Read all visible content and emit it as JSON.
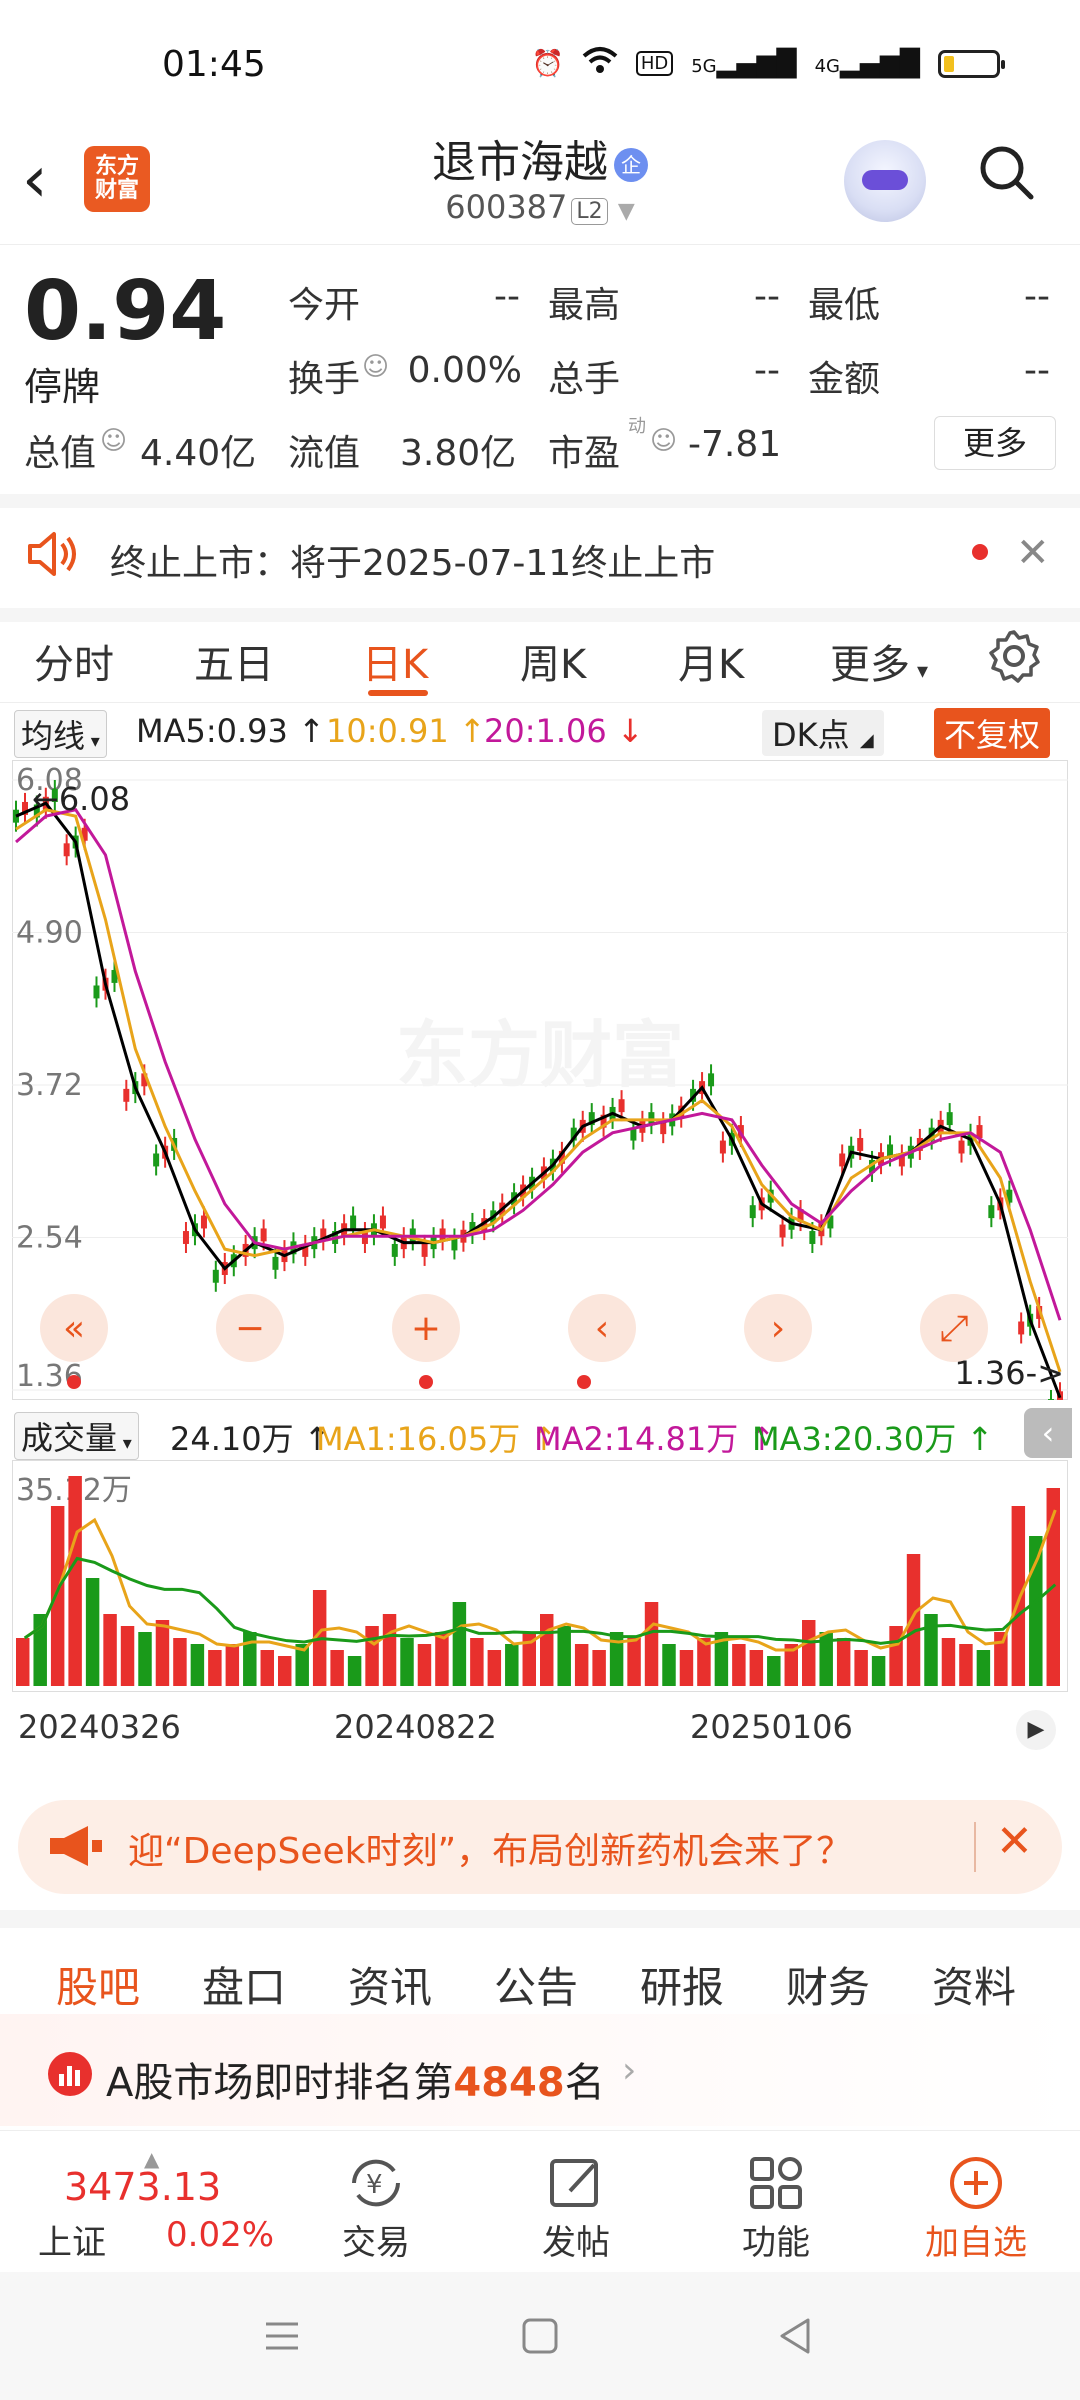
{
  "status_bar": {
    "time": "01:45",
    "network": "HD",
    "sig1": "5G",
    "sig2": "4G"
  },
  "header": {
    "title": "退市海越",
    "badge": "企",
    "code": "600387",
    "level": "L2",
    "logo_line1": "东方",
    "logo_line2": "财富"
  },
  "quote": {
    "price": "0.94",
    "status": "停牌",
    "fields": [
      {
        "label": "今开",
        "value": "--"
      },
      {
        "label": "最高",
        "value": "--"
      },
      {
        "label": "最低",
        "value": "--"
      },
      {
        "label": "换手",
        "value": "0.00%"
      },
      {
        "label": "总手",
        "value": "--"
      },
      {
        "label": "金额",
        "value": "--"
      },
      {
        "label": "总值",
        "value": "4.40亿"
      },
      {
        "label": "流值",
        "value": "3.80亿"
      },
      {
        "label": "市盈",
        "value": "-7.81",
        "sup": "动"
      }
    ],
    "more_label": "更多"
  },
  "notice": {
    "text": "终止上市：将于2025-07-11终止上市"
  },
  "tabs": [
    "分时",
    "五日",
    "日K",
    "周K",
    "月K",
    "更多"
  ],
  "active_tab": "日K",
  "ma": {
    "selector": "均线",
    "ma5": "MA5:0.93",
    "ma10": "10:0.91",
    "ma20": "20:1.06",
    "dk_label": "DK点",
    "adjust_label": "不复权",
    "colors": {
      "ma5": "#000000",
      "ma10": "#e8a41a",
      "ma20": "#c2189a",
      "up": "#e8302d",
      "down": "#1a9a1a"
    }
  },
  "chart_data": [
    {
      "type": "line",
      "title": "日K",
      "y_ticks": [
        "6.08",
        "4.90",
        "3.72",
        "2.54",
        "1.36"
      ],
      "ylim": [
        1.36,
        6.08
      ],
      "high_marker": "6.08",
      "low_marker": "1.36",
      "x_labels": [
        "20240326",
        "20240822",
        "20250106"
      ],
      "watermark": "东方财富",
      "series": [
        {
          "name": "MA5",
          "values": [
            5.8,
            5.9,
            5.6,
            4.5,
            3.7,
            3.2,
            2.6,
            2.3,
            2.5,
            2.4,
            2.5,
            2.6,
            2.6,
            2.5,
            2.5,
            2.55,
            2.7,
            2.9,
            3.1,
            3.4,
            3.5,
            3.4,
            3.45,
            3.7,
            3.3,
            2.8,
            2.65,
            2.6,
            3.2,
            3.15,
            3.2,
            3.4,
            3.3,
            2.8,
            1.9,
            1.3
          ]
        },
        {
          "name": "10",
          "values": [
            5.7,
            5.85,
            5.8,
            5.0,
            4.0,
            3.4,
            2.9,
            2.45,
            2.4,
            2.45,
            2.5,
            2.55,
            2.6,
            2.55,
            2.5,
            2.55,
            2.65,
            2.85,
            3.05,
            3.3,
            3.45,
            3.45,
            3.45,
            3.6,
            3.4,
            2.95,
            2.7,
            2.6,
            3.0,
            3.15,
            3.2,
            3.35,
            3.35,
            3.0,
            2.2,
            1.5
          ]
        },
        {
          "name": "20",
          "values": [
            5.6,
            5.8,
            5.85,
            5.5,
            4.6,
            3.9,
            3.3,
            2.8,
            2.5,
            2.45,
            2.5,
            2.55,
            2.55,
            2.55,
            2.55,
            2.55,
            2.6,
            2.75,
            2.95,
            3.2,
            3.35,
            3.4,
            3.45,
            3.5,
            3.45,
            3.1,
            2.8,
            2.65,
            2.9,
            3.1,
            3.2,
            3.3,
            3.35,
            3.2,
            2.6,
            1.9
          ]
        }
      ]
    },
    {
      "type": "bar",
      "title": "成交量",
      "y_max_label": "35.12万",
      "current": "24.10万",
      "ma1": "MA1:16.05万",
      "ma2": "MA2:14.81万",
      "ma3": "MA3:20.30万",
      "values": [
        8,
        12,
        30,
        35,
        18,
        12,
        10,
        9,
        11,
        8,
        7,
        6,
        7,
        9,
        6,
        5,
        7,
        16,
        6,
        5,
        10,
        12,
        8,
        7,
        9,
        14,
        8,
        6,
        7,
        9,
        12,
        10,
        7,
        6,
        9,
        8,
        14,
        7,
        6,
        8,
        9,
        7,
        6,
        5,
        7,
        11,
        9,
        8,
        6,
        5,
        10,
        22,
        12,
        8,
        7,
        6,
        9,
        30,
        25,
        33
      ]
    }
  ],
  "controls": [
    "«",
    "−",
    "+",
    "‹",
    "›",
    "⤢"
  ],
  "ad": {
    "text": "迎“DeepSeek时刻”，布局创新药机会来了？"
  },
  "bottom_tabs": [
    "股吧",
    "盘口",
    "资讯",
    "公告",
    "研报",
    "财务",
    "资料"
  ],
  "rank": {
    "prefix": "A股市场即时排名第",
    "number": "4848",
    "suffix": "名"
  },
  "bottom_bar": {
    "index_value": "3473.13",
    "index_name": "上证",
    "index_change": "0.02%",
    "items": [
      {
        "label": "交易",
        "icon": "trade-icon"
      },
      {
        "label": "发帖",
        "icon": "post-icon"
      },
      {
        "label": "功能",
        "icon": "grid-icon"
      },
      {
        "label": "加自选",
        "icon": "add-icon"
      }
    ]
  }
}
